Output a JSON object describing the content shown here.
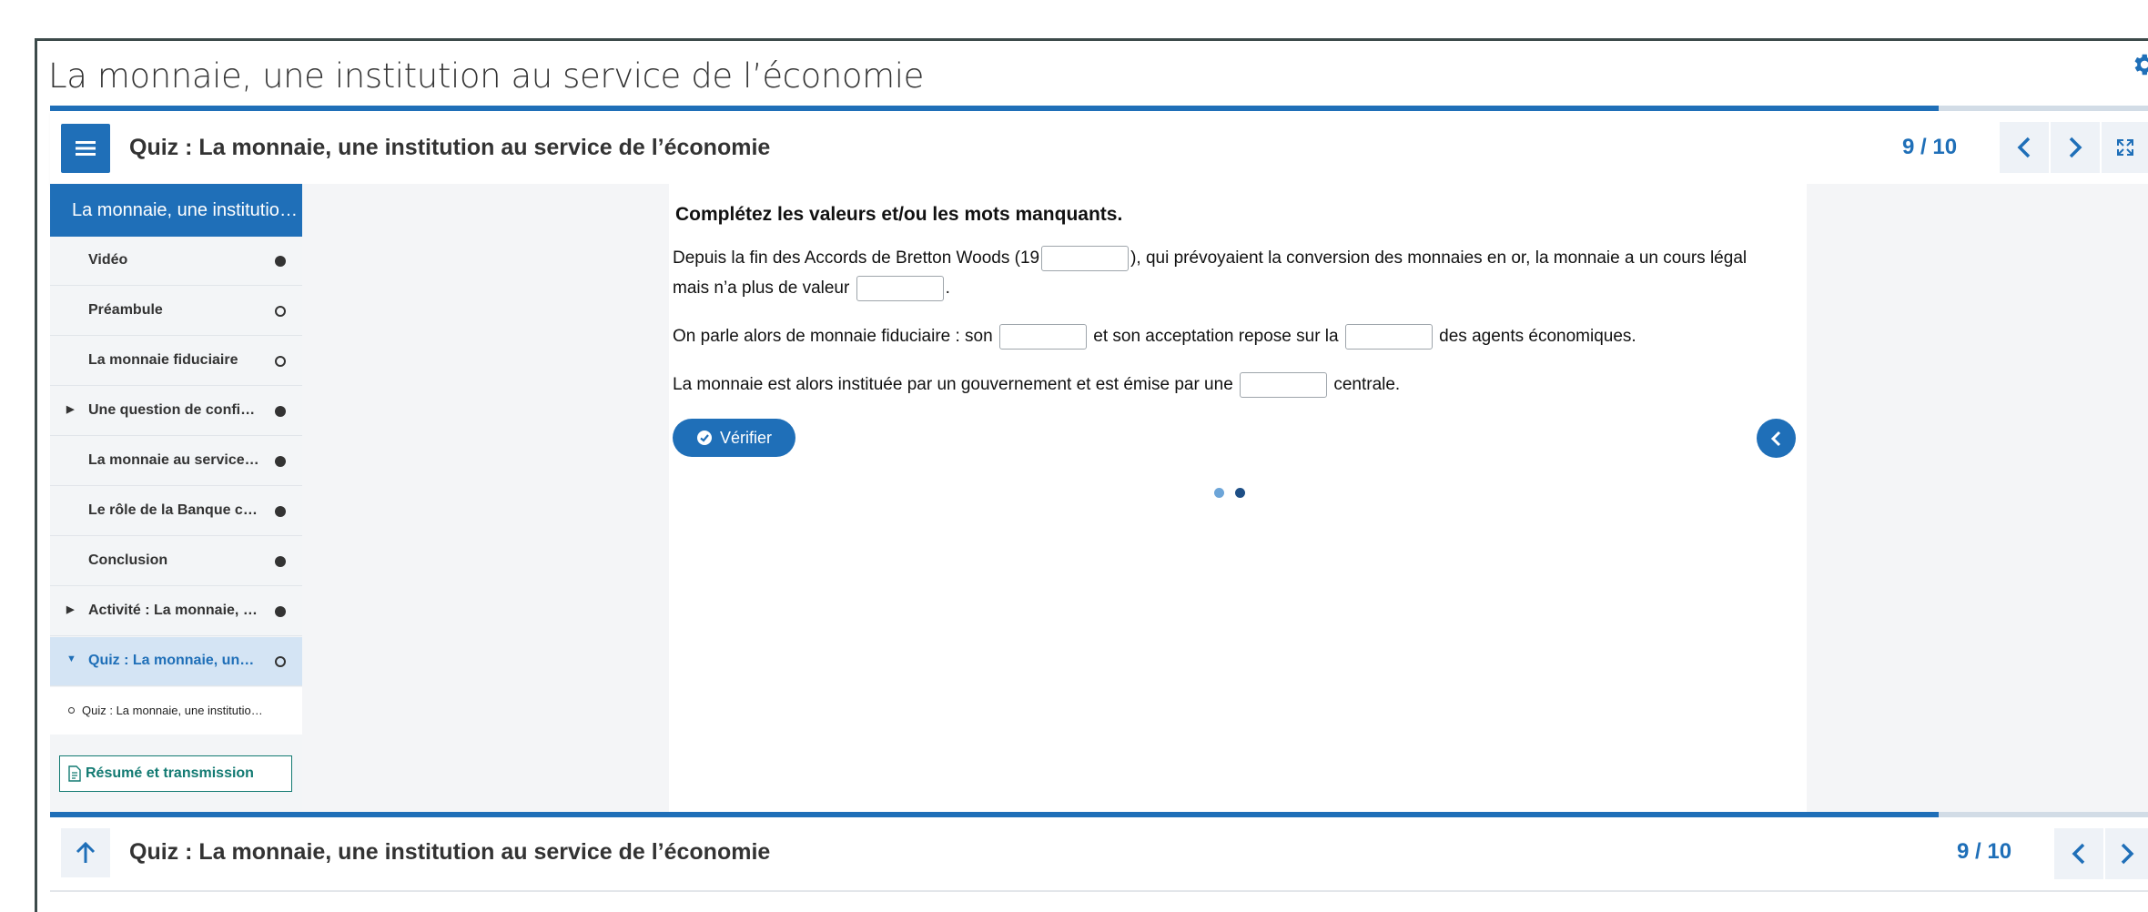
{
  "course": {
    "title": "La monnaie, une institution au service de l’économie"
  },
  "header": {
    "title": "Quiz : La monnaie, une institution au service de l’économie",
    "page_counter": "9 / 10",
    "progress": 0.9
  },
  "sidebar": {
    "head": "La monnaie, une institution au service de l’économie",
    "items": [
      {
        "label": "Vidéo",
        "status": "complete",
        "expandable": false
      },
      {
        "label": "Préambule",
        "status": "incomplete",
        "expandable": false
      },
      {
        "label": "La monnaie fiduciaire",
        "status": "incomplete",
        "expandable": false
      },
      {
        "label": "Une question de confiance",
        "status": "complete",
        "expandable": true
      },
      {
        "label": "La monnaie au service de l’économie",
        "status": "complete",
        "expandable": false
      },
      {
        "label": "Le rôle de la Banque centrale",
        "status": "complete",
        "expandable": false
      },
      {
        "label": "Conclusion",
        "status": "complete",
        "expandable": false
      },
      {
        "label": "Activité : La monnaie, une institution",
        "status": "complete",
        "expandable": true
      },
      {
        "label": "Quiz : La monnaie, une institution",
        "status": "incomplete",
        "expandable": true,
        "active": true
      }
    ],
    "subitem": "Quiz : La monnaie, une institution au service de l’économie",
    "summary_button": "Résumé et transmission"
  },
  "quiz": {
    "instruction": "Complétez les valeurs et/ou les mots manquants.",
    "p1_a": "Depuis la fin des Accords de Bretton Woods (19",
    "p1_b": "), qui prévoyaient la conversion des monnaies en or, la monnaie a un cours légal",
    "p1_c": "mais n’a plus de valeur",
    "p1_d": ".",
    "p2_a": "On parle alors de monnaie fiduciaire : son",
    "p2_b": "et son acceptation repose sur la",
    "p2_c": "des agents économiques.",
    "p3_a": "La monnaie est alors instituée par un gouvernement et est émise par une",
    "p3_b": "centrale.",
    "verify_button": "Vérifier"
  },
  "footer": {
    "title": "Quiz : La monnaie, une institution au service de l’économie",
    "page_counter": "9 / 10"
  },
  "colors": {
    "accent": "#1f6fb8",
    "teal": "#127a72",
    "active_bg": "#d4e4f4"
  },
  "icons": [
    "gear-icon",
    "hamburger-menu-icon",
    "chevron-left-icon",
    "chevron-right-icon",
    "fullscreen-icon",
    "check-circle-icon",
    "document-icon",
    "arrow-up-icon"
  ]
}
